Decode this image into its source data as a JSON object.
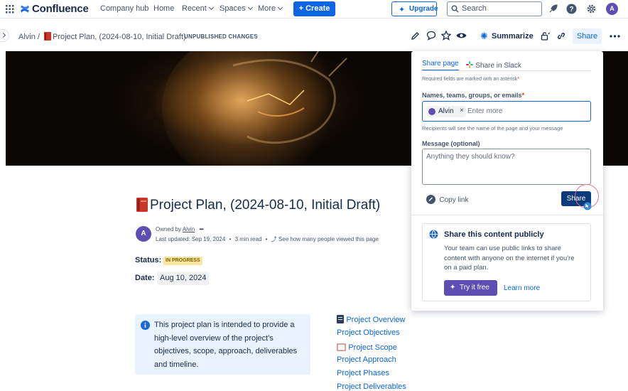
{
  "nav": {
    "brand": "Confluence",
    "company_hub": "Company hub",
    "home": "Home",
    "recent": "Recent",
    "spaces": "Spaces",
    "more": "More",
    "create": "+ Create",
    "upgrade": "Upgrade",
    "search_placeholder": "Search",
    "avatar_letter": "A"
  },
  "breadcrumb": {
    "space": "Alvin",
    "separator": "/",
    "page": "Project Plan, (2024-08-10, Initial Draft)",
    "status": "UNPUBLISHED CHANGES"
  },
  "toolbar": {
    "summarize": "Summarize",
    "share": "Share"
  },
  "page": {
    "title": "Project Plan, (2024-08-10, Initial Draft)",
    "owned_by": "Owned by",
    "owner": "Alvin",
    "last_updated": "Last updated: Sep 19, 2024",
    "read_time": "3 min read",
    "views_link": "See how many people viewed this page",
    "status_label": "Status:",
    "status_value": "IN PROGRESS",
    "date_label": "Date:",
    "date_value": "Aug 10, 2024",
    "info_text": "This project plan is intended to provide a high-level overview of the project's objectives, scope, approach, deliverables and timeline."
  },
  "toc": [
    "Project Overview",
    "Project Objectives",
    "Project Scope",
    "Project Approach",
    "Project Phases",
    "Project Deliverables"
  ],
  "share_panel": {
    "tab_share_page": "Share page",
    "tab_share_slack": "Share in Slack",
    "required_note": "Required fields are marked with an asterisk",
    "names_label": "Names, teams, groups, or emails",
    "recipient": "Alvin",
    "names_placeholder": "Enter more",
    "recipients_note": "Recipients will see the name of the page and your message",
    "message_label": "Message (optional)",
    "message_placeholder": "Anything they should know?",
    "copy_link": "Copy link",
    "share_button": "Share",
    "public_title": "Share this content publicly",
    "public_text": "Your team can use public links to share content with anyone on the internet if you're on a paid plan.",
    "try_free": "Try it free",
    "learn_more": "Learn more"
  },
  "colors": {
    "primary": "#0c66e4",
    "share_button": "#0c3a7a",
    "status_badge": "#f8e6a0",
    "info_bg": "#e9f2ff",
    "try_button": "#5e4db2"
  }
}
